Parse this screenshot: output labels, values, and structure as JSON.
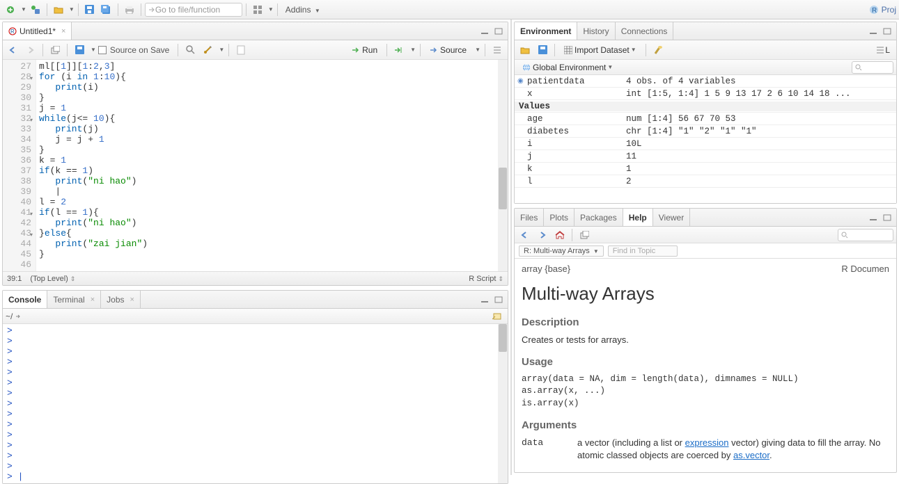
{
  "toolbar": {
    "goto_placeholder": "Go to file/function",
    "addins_label": "Addins",
    "project_label": "Proj"
  },
  "source": {
    "tab_title": "Untitled1*",
    "source_on_save": "Source on Save",
    "run_label": "Run",
    "source_label": "Source",
    "cursor_pos": "39:1",
    "scope": "(Top Level)",
    "lang": "R Script",
    "lines": [
      {
        "n": 27,
        "t": "ml[[1]][1:2,3]"
      },
      {
        "n": 28,
        "fold": true,
        "t": "for (i in 1:10){"
      },
      {
        "n": 29,
        "t": "   print(i)"
      },
      {
        "n": 30,
        "t": "}"
      },
      {
        "n": 31,
        "t": "j = 1"
      },
      {
        "n": 32,
        "fold": true,
        "t": "while(j<= 10){"
      },
      {
        "n": 33,
        "t": "   print(j)"
      },
      {
        "n": 34,
        "t": "   j = j + 1"
      },
      {
        "n": 35,
        "t": "}"
      },
      {
        "n": 36,
        "t": "k = 1"
      },
      {
        "n": 37,
        "t": "if(k == 1)"
      },
      {
        "n": 38,
        "t": "   print(\"ni hao\")"
      },
      {
        "n": 39,
        "t": "   |"
      },
      {
        "n": 40,
        "t": "l = 2"
      },
      {
        "n": 41,
        "fold": true,
        "t": "if(l == 1){"
      },
      {
        "n": 42,
        "t": "   print(\"ni hao\")"
      },
      {
        "n": 43,
        "fold": true,
        "t": "}else{"
      },
      {
        "n": 44,
        "t": "   print(\"zai jian\")"
      },
      {
        "n": 45,
        "t": "}"
      },
      {
        "n": 46,
        "t": ""
      }
    ]
  },
  "console": {
    "tabs": [
      "Console",
      "Terminal",
      "Jobs"
    ],
    "path": "~/",
    "prompt_count": 14
  },
  "env": {
    "tabs": [
      "Environment",
      "History",
      "Connections"
    ],
    "import_label": "Import Dataset",
    "list_label": "L",
    "scope": "Global Environment",
    "rows": [
      {
        "name": "patientdata",
        "value": "4 obs. of 4 variables",
        "expand": true
      },
      {
        "name": "x",
        "value": "int [1:5, 1:4] 1 5 9 13 17 2 6 10 14 18 ..."
      }
    ],
    "values_hdr": "Values",
    "values": [
      {
        "name": "age",
        "value": "num [1:4] 56 67 70 53"
      },
      {
        "name": "diabetes",
        "value": "chr [1:4] \"1\" \"2\" \"1\" \"1\""
      },
      {
        "name": "i",
        "value": "10L"
      },
      {
        "name": "j",
        "value": "11"
      },
      {
        "name": "k",
        "value": "1"
      },
      {
        "name": "l",
        "value": "2"
      }
    ]
  },
  "help": {
    "tabs": [
      "Files",
      "Plots",
      "Packages",
      "Help",
      "Viewer"
    ],
    "crumb": "R: Multi-way Arrays",
    "find_placeholder": "Find in Topic",
    "pkg": "array {base}",
    "doc_label": "R Documen",
    "title": "Multi-way Arrays",
    "desc_h": "Description",
    "desc": "Creates or tests for arrays.",
    "usage_h": "Usage",
    "usage_code": "array(data = NA, dim = length(data), dimnames = NULL)\nas.array(x, ...)\nis.array(x)",
    "args_h": "Arguments",
    "arg_data_name": "data",
    "arg_data_pre": "a vector (including a list or ",
    "arg_data_link1": "expression",
    "arg_data_mid": " vector) giving data to fill the array. No atomic classed objects are coerced by ",
    "arg_data_link2": "as.vector",
    "arg_data_post": "."
  }
}
